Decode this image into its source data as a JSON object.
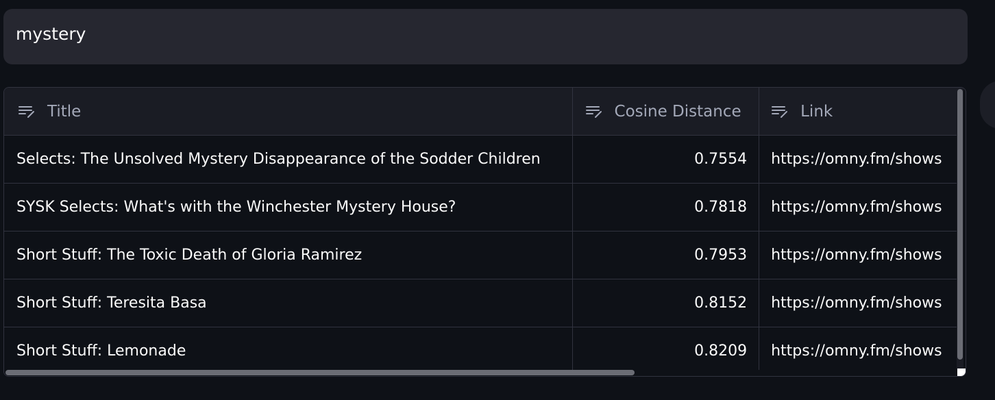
{
  "search": {
    "value": "mystery"
  },
  "table": {
    "columns": [
      {
        "label": "Title",
        "icon": "edit-text-icon"
      },
      {
        "label": "Cosine Distance",
        "icon": "edit-text-icon"
      },
      {
        "label": "Link",
        "icon": "edit-text-icon"
      }
    ],
    "rows": [
      {
        "title": "Selects: The Unsolved Mystery Disappearance of the Sodder Children",
        "distance": "0.7554",
        "link": "https://omny.fm/shows"
      },
      {
        "title": "SYSK Selects: What's with the Winchester Mystery House?",
        "distance": "0.7818",
        "link": "https://omny.fm/shows"
      },
      {
        "title": "Short Stuff: The Toxic Death of Gloria Ramirez",
        "distance": "0.7953",
        "link": "https://omny.fm/shows"
      },
      {
        "title": "Short Stuff: Teresita Basa",
        "distance": "0.8152",
        "link": "https://omny.fm/shows"
      },
      {
        "title": "Short Stuff: Lemonade",
        "distance": "0.8209",
        "link": "https://omny.fm/shows"
      }
    ]
  },
  "colors": {
    "background": "#0e1117",
    "input_bg": "#262730",
    "header_bg": "#1a1c24",
    "border": "#31333f",
    "text": "#fafafa",
    "header_text": "#a3a8b8"
  }
}
